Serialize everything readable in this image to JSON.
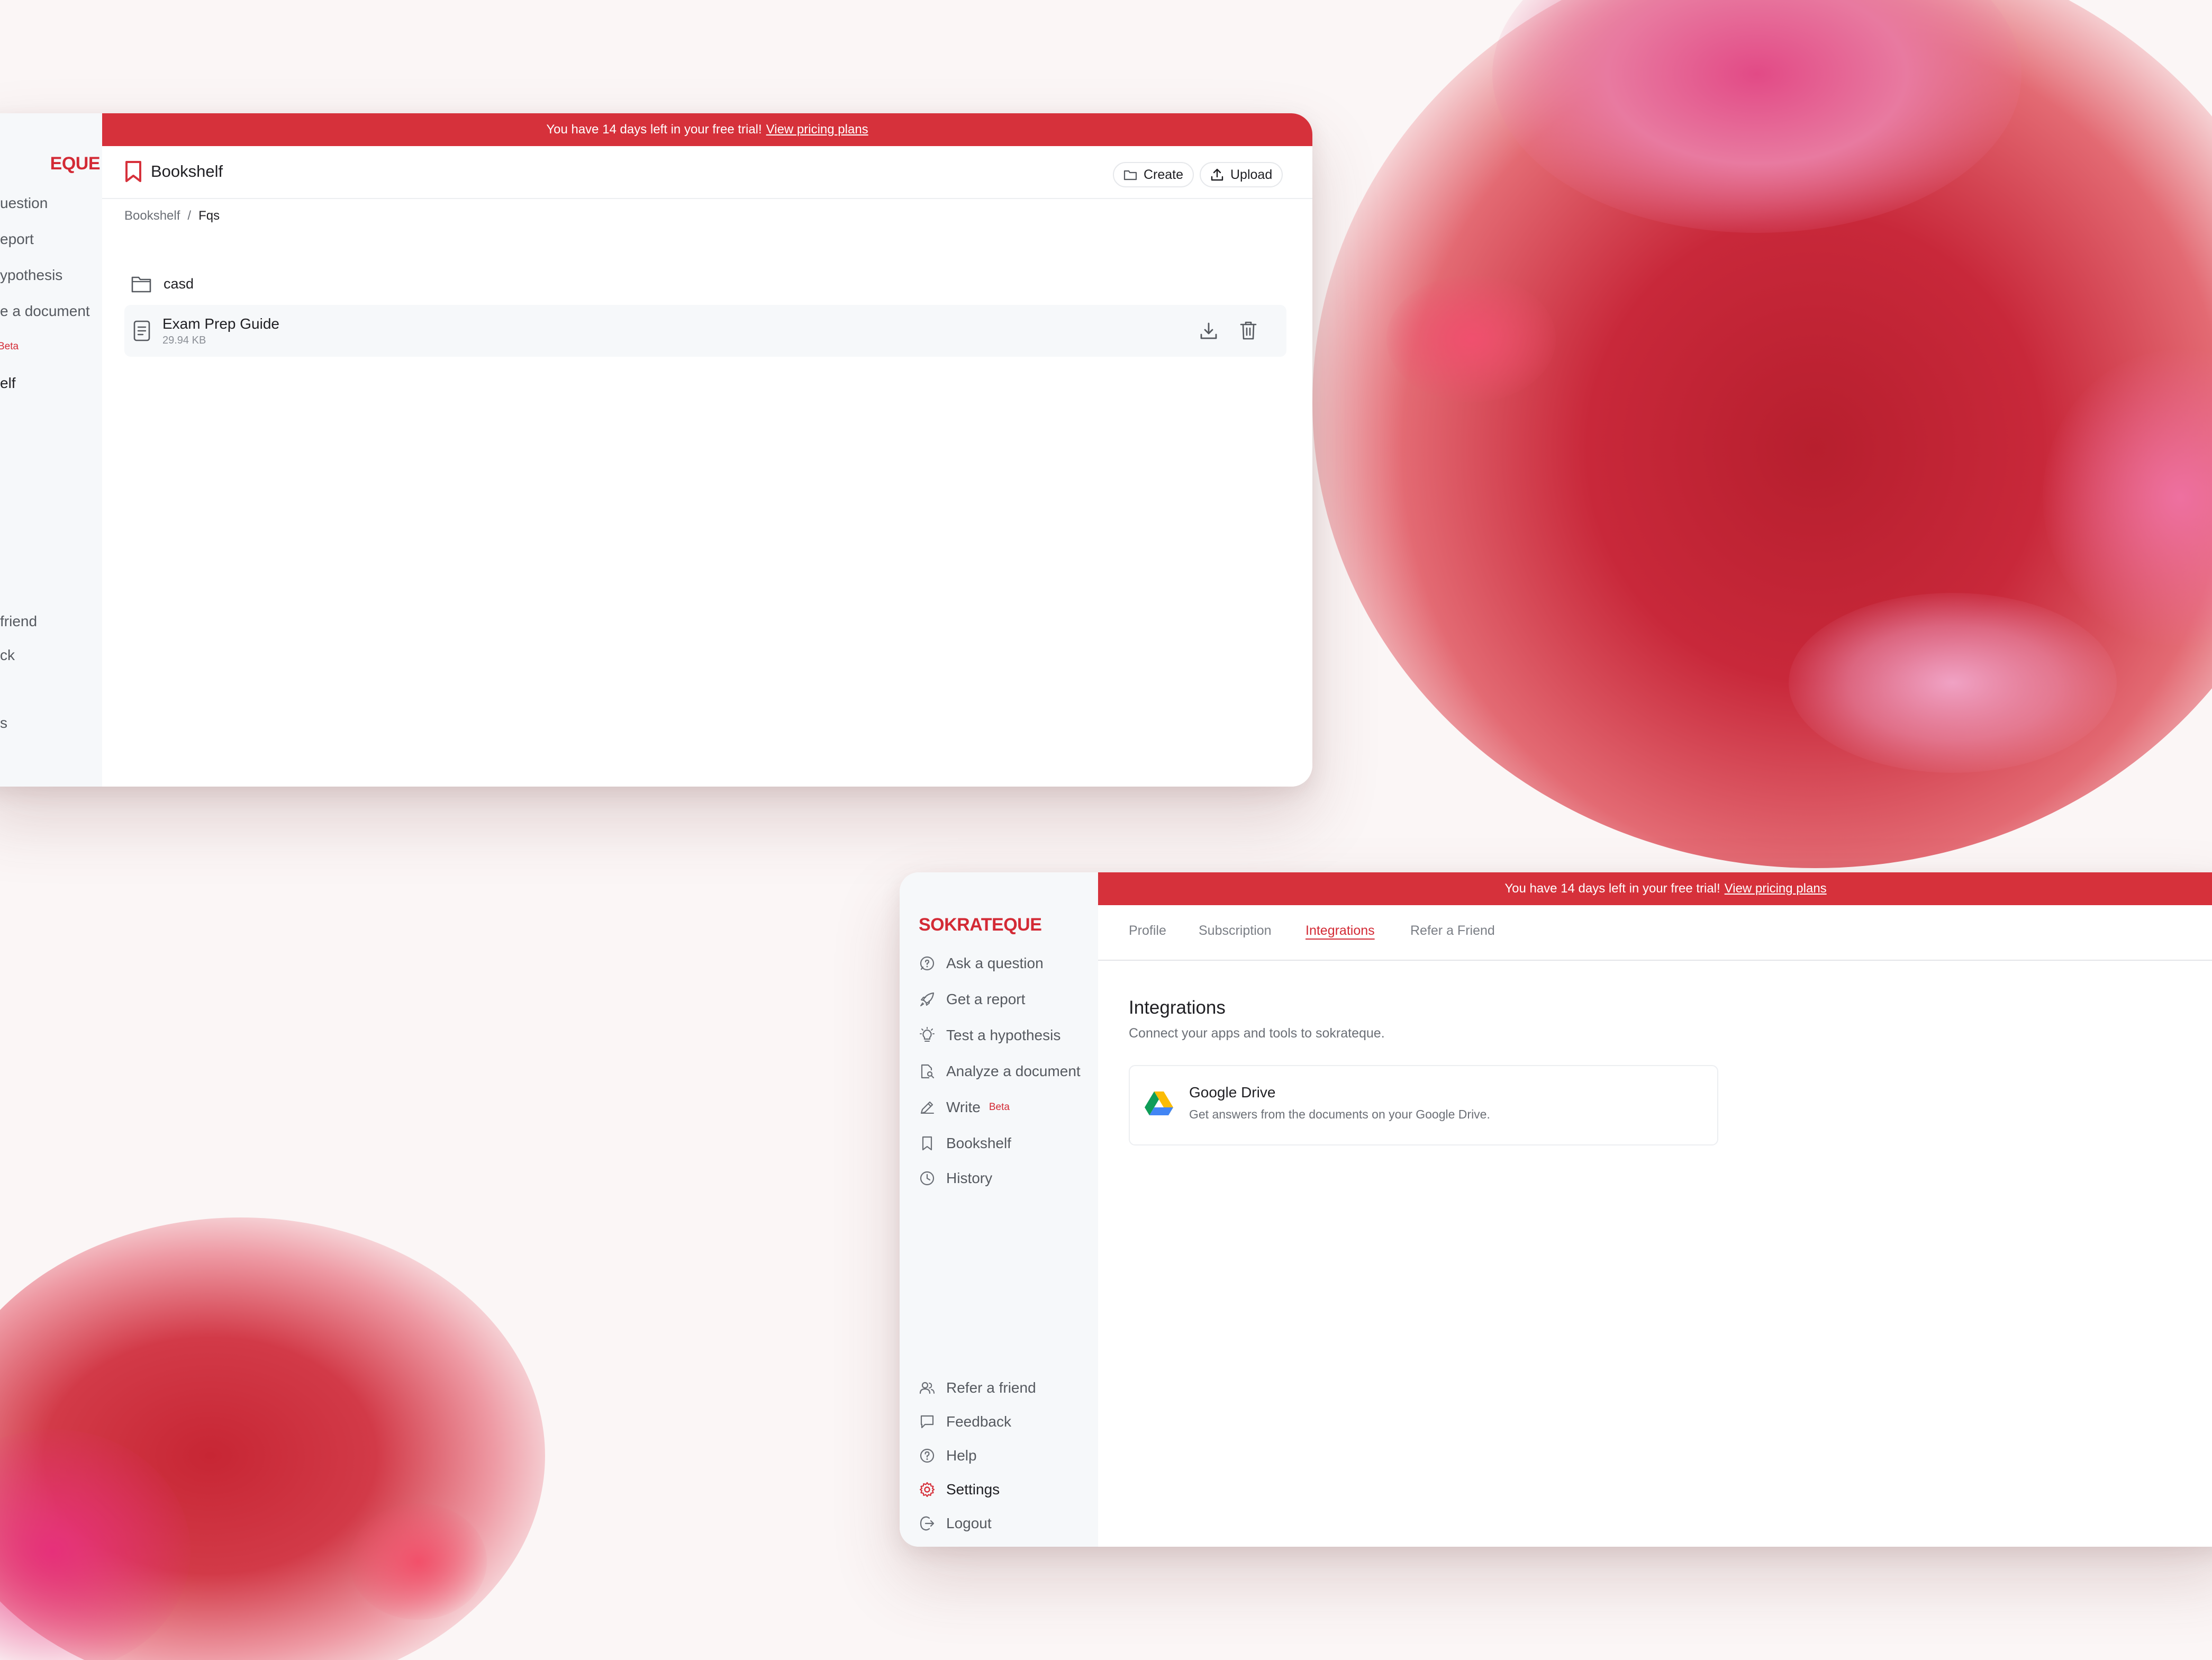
{
  "trial_banner": {
    "message": "You have 14 days left in your free trial!",
    "link": "View pricing plans"
  },
  "window1": {
    "sidebar": {
      "brand": "EQUE",
      "items": [
        {
          "label": "uestion"
        },
        {
          "label": "eport"
        },
        {
          "label": "ypothesis"
        },
        {
          "label": "e a document"
        },
        {
          "label": "Beta"
        },
        {
          "label": "elf"
        },
        {
          "label": "friend"
        },
        {
          "label": "ck"
        },
        {
          "label": "s"
        }
      ]
    },
    "page_title": "Bookshelf",
    "create_label": "Create",
    "upload_label": "Upload",
    "breadcrumb": {
      "root": "Bookshelf",
      "separator": "/",
      "current": "Fqs"
    },
    "folder": {
      "name": "casd",
      "icon": "folder-icon"
    },
    "file": {
      "name": "Exam Prep Guide",
      "size": "29.94 KB",
      "icon": "document-icon"
    }
  },
  "window2": {
    "sidebar": {
      "brand": "SOKRATEQUE",
      "items": [
        {
          "label": "Ask a question",
          "icon": "chat-question-icon"
        },
        {
          "label": "Get a report",
          "icon": "rocket-icon"
        },
        {
          "label": "Test a hypothesis",
          "icon": "lightbulb-icon"
        },
        {
          "label": "Analyze a document",
          "icon": "document-search-icon"
        },
        {
          "label": "Write",
          "icon": "pen-icon",
          "badge": "Beta"
        },
        {
          "label": "Bookshelf",
          "icon": "bookmark-icon"
        },
        {
          "label": "History",
          "icon": "clock-icon"
        }
      ],
      "bottom_items": [
        {
          "label": "Refer a friend",
          "icon": "users-icon"
        },
        {
          "label": "Feedback",
          "icon": "message-icon"
        },
        {
          "label": "Help",
          "icon": "help-icon"
        },
        {
          "label": "Settings",
          "icon": "gear-icon",
          "active": true
        },
        {
          "label": "Logout",
          "icon": "logout-icon"
        }
      ]
    },
    "tabs": [
      {
        "label": "Profile"
      },
      {
        "label": "Subscription"
      },
      {
        "label": "Integrations",
        "active": true
      },
      {
        "label": "Refer a Friend"
      }
    ],
    "section": {
      "title": "Integrations",
      "subtitle": "Connect your apps and tools to sokrateque."
    },
    "integration": {
      "name": "Google Drive",
      "description": "Get answers from the documents on your Google Drive.",
      "icon": "google-drive-icon"
    }
  },
  "colors": {
    "accent": "#d6313b",
    "sidebar_bg": "#f6f8fa",
    "text": "#1f1f23",
    "muted": "#6b6f76"
  }
}
